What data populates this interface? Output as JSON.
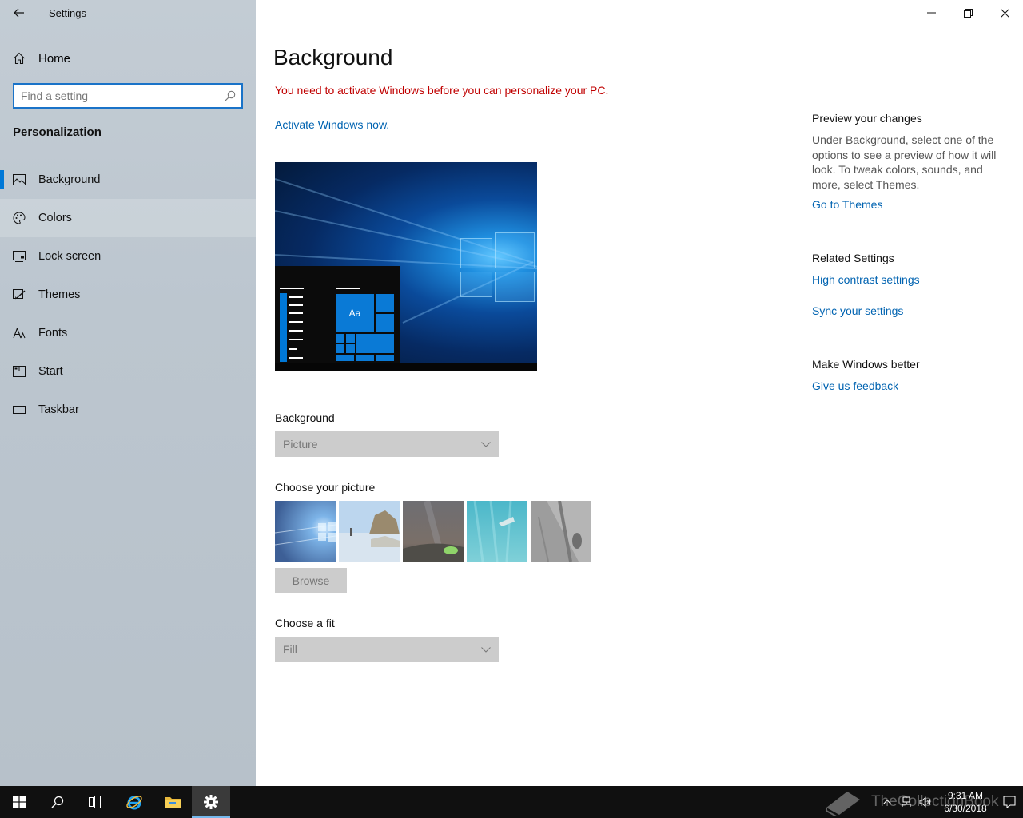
{
  "window": {
    "title": "Settings"
  },
  "sidebar": {
    "home_label": "Home",
    "search_placeholder": "Find a setting",
    "section_title": "Personalization",
    "items": [
      {
        "label": "Background",
        "icon": "picture-icon"
      },
      {
        "label": "Colors",
        "icon": "palette-icon"
      },
      {
        "label": "Lock screen",
        "icon": "lock-screen-icon"
      },
      {
        "label": "Themes",
        "icon": "brush-icon"
      },
      {
        "label": "Fonts",
        "icon": "font-icon"
      },
      {
        "label": "Start",
        "icon": "start-icon"
      },
      {
        "label": "Taskbar",
        "icon": "taskbar-icon"
      }
    ],
    "selected_item": "Background",
    "hover_item": "Colors"
  },
  "main": {
    "title": "Background",
    "warning": "You need to activate Windows before you can personalize your PC.",
    "activate_link": "Activate Windows now.",
    "preview_tile_text": "Aa",
    "background_label": "Background",
    "background_value": "Picture",
    "choose_picture_label": "Choose your picture",
    "browse_label": "Browse",
    "fit_label": "Choose a fit",
    "fit_value": "Fill"
  },
  "right_panel": {
    "preview_heading": "Preview your changes",
    "preview_text": "Under Background, select one of the options to see a preview of how it will look. To tweak colors, sounds, and more, select Themes.",
    "themes_link": "Go to Themes",
    "related_heading": "Related Settings",
    "high_contrast_link": "High contrast settings",
    "sync_link": "Sync your settings",
    "feedback_heading": "Make Windows better",
    "feedback_link": "Give us feedback"
  },
  "taskbar": {
    "time": "9:31 AM",
    "date": "6/30/2018",
    "watermark": "TheCollectionBook"
  },
  "colors": {
    "accent": "#0078d7",
    "link": "#0063b1",
    "warning": "#c00000"
  }
}
